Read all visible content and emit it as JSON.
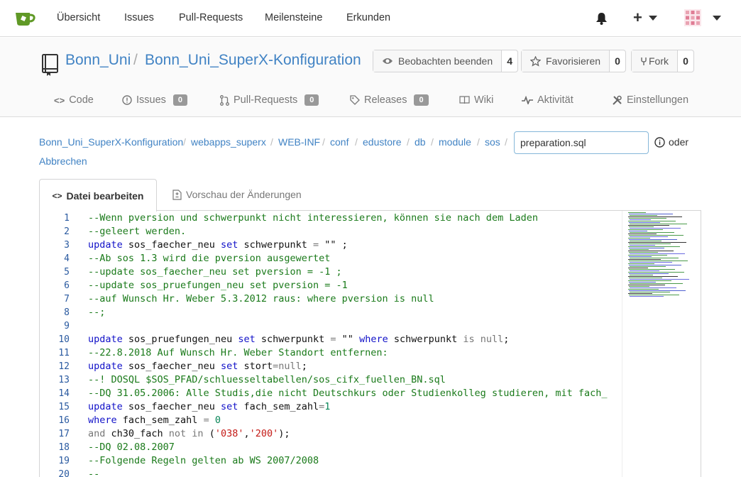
{
  "nav": {
    "items": [
      "Übersicht",
      "Issues",
      "Pull-Requests",
      "Meilensteine",
      "Erkunden"
    ],
    "plus_label": "+"
  },
  "repo": {
    "owner": "Bonn_Uni",
    "separator": "/",
    "name": "Bonn_Uni_SuperX-Konfiguration",
    "watch_label": "Beobachten beenden",
    "watch_count": "4",
    "star_label": "Favorisieren",
    "star_count": "0",
    "fork_label": "Fork",
    "fork_count": "0"
  },
  "tabs": {
    "code": "Code",
    "issues": "Issues",
    "issues_count": "0",
    "pulls": "Pull-Requests",
    "pulls_count": "0",
    "releases": "Releases",
    "releases_count": "0",
    "wiki": "Wiki",
    "activity": "Aktivität",
    "settings": "Einstellungen"
  },
  "breadcrumb": {
    "parts": [
      "Bonn_Uni_SuperX-Konfiguration",
      "webapps_superx",
      "WEB-INF",
      "conf",
      "edustore",
      "db",
      "module",
      "sos"
    ],
    "separator": "/",
    "filename": "preparation.sql",
    "oder": "oder",
    "cancel": "Abbrechen"
  },
  "edit_tabs": {
    "edit": "Datei bearbeiten",
    "preview": "Vorschau der Änderungen"
  },
  "editor": {
    "line_numbers": [
      "1",
      "2",
      "3",
      "4",
      "5",
      "6",
      "7",
      "8",
      "9",
      "10",
      "11",
      "12",
      "13",
      "14",
      "15",
      "16",
      "17",
      "18",
      "19",
      "20"
    ],
    "lines": [
      [
        [
          "c",
          "--Wenn pversion und schwerpunkt nicht interessieren, können sie nach dem Laden"
        ]
      ],
      [
        [
          "c",
          "--geleert werden."
        ]
      ],
      [
        [
          "k",
          "update"
        ],
        [
          "p",
          " sos_faecher_neu "
        ],
        [
          "k",
          "set"
        ],
        [
          "p",
          " schwerpunkt "
        ],
        [
          "o",
          "="
        ],
        [
          "p",
          " \"\" ;"
        ]
      ],
      [
        [
          "c",
          "--Ab sos 1.3 wird die pversion ausgewertet"
        ]
      ],
      [
        [
          "c",
          "--update sos_faecher_neu set pversion = -1 ;"
        ]
      ],
      [
        [
          "c",
          "--update sos_pruefungen_neu set pversion = -1"
        ]
      ],
      [
        [
          "c",
          "--auf Wunsch Hr. Weber 5.3.2012 raus: where pversion is null"
        ]
      ],
      [
        [
          "c",
          "--;"
        ]
      ],
      [
        [
          "p",
          ""
        ]
      ],
      [
        [
          "k",
          "update"
        ],
        [
          "p",
          " sos_pruefungen_neu "
        ],
        [
          "k",
          "set"
        ],
        [
          "p",
          " schwerpunkt "
        ],
        [
          "o",
          "="
        ],
        [
          "p",
          " \"\" "
        ],
        [
          "k",
          "where"
        ],
        [
          "p",
          " schwerpunkt "
        ],
        [
          "o",
          "is"
        ],
        [
          "p",
          " "
        ],
        [
          "o",
          "null"
        ],
        [
          "p",
          ";"
        ]
      ],
      [
        [
          "c",
          "--22.8.2018 Auf Wunsch Hr. Weber Standort entfernen:"
        ]
      ],
      [
        [
          "k",
          "update"
        ],
        [
          "p",
          " sos_faecher_neu "
        ],
        [
          "k",
          "set"
        ],
        [
          "p",
          " stort"
        ],
        [
          "o",
          "=null"
        ],
        [
          "p",
          ";"
        ]
      ],
      [
        [
          "c",
          "--! DOSQL $SOS_PFAD/schluesseltabellen/sos_cifx_fuellen_BN.sql"
        ]
      ],
      [
        [
          "c",
          "--DQ 31.05.2006: Alle Studis,die nicht Deutschkurs oder Studienkolleg studieren, mit fach_"
        ]
      ],
      [
        [
          "k",
          "update"
        ],
        [
          "p",
          " sos_faecher_neu "
        ],
        [
          "k",
          "set"
        ],
        [
          "p",
          " fach_sem_zahl"
        ],
        [
          "o",
          "="
        ],
        [
          "n",
          "1"
        ]
      ],
      [
        [
          "k",
          "where"
        ],
        [
          "p",
          " fach_sem_zahl "
        ],
        [
          "o",
          "="
        ],
        [
          "p",
          " "
        ],
        [
          "n",
          "0"
        ]
      ],
      [
        [
          "o",
          "and"
        ],
        [
          "p",
          " ch30_fach "
        ],
        [
          "o",
          "not in"
        ],
        [
          "p",
          " ("
        ],
        [
          "s",
          "'038'"
        ],
        [
          "p",
          ","
        ],
        [
          "s",
          "'200'"
        ],
        [
          "p",
          ");"
        ]
      ],
      [
        [
          "c",
          "--DQ 02.08.2007"
        ]
      ],
      [
        [
          "c",
          "--Folgende Regeln gelten ab WS 2007/2008"
        ]
      ],
      [
        [
          "c",
          "--"
        ]
      ]
    ]
  },
  "colors": {
    "link": "#4183c4",
    "comment": "#1a7a1a",
    "keyword": "#1010c8",
    "string": "#c41a16",
    "logo": "#609926"
  }
}
